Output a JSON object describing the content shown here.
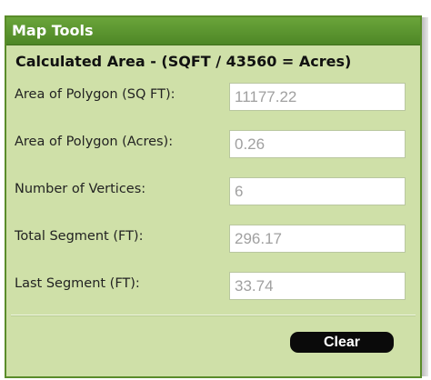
{
  "panel": {
    "title": "Map Tools",
    "heading": "Calculated Area - (SQFT / 43560 = Acres)"
  },
  "fields": [
    {
      "label": "Area of Polygon (SQ FT):",
      "value": "11177.22"
    },
    {
      "label": "Area of Polygon (Acres):",
      "value": "0.26"
    },
    {
      "label": "Number of Vertices:",
      "value": "6"
    },
    {
      "label": "Total Segment (FT):",
      "value": "296.17"
    },
    {
      "label": "Last Segment (FT):",
      "value": "33.74"
    }
  ],
  "buttons": {
    "clear_label": "Clear"
  },
  "colors": {
    "title_bar": "#5a9630",
    "panel_background": "#cfe0a8",
    "field_text": "#a0a0a0"
  }
}
